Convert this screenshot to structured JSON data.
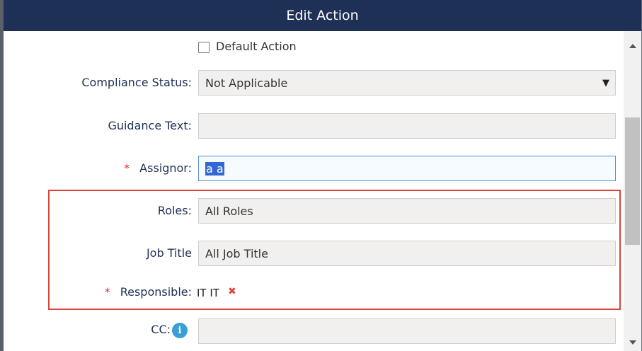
{
  "dialog": {
    "title": "Edit Action"
  },
  "form": {
    "default_action": {
      "label": "Default Action",
      "checked": false
    },
    "compliance_status": {
      "label": "Compliance Status:",
      "value": "Not Applicable"
    },
    "guidance_text": {
      "label": "Guidance Text:",
      "value": ""
    },
    "assignor": {
      "label": "Assignor:",
      "required_mark": "*",
      "value": "a a"
    },
    "roles": {
      "label": "Roles:",
      "value": "All Roles"
    },
    "job_title": {
      "label": "Job Title",
      "value": "All Job Title"
    },
    "responsible": {
      "label": "Responsible:",
      "required_mark": "*",
      "value": "IT IT",
      "remove_glyph": "✖"
    },
    "cc": {
      "label": "CC:",
      "info_glyph": "i",
      "value": ""
    }
  },
  "icons": {
    "dropdown": "caret-down-icon",
    "remove": "remove-icon",
    "info": "info-icon"
  },
  "colors": {
    "header_bg": "#1f3057",
    "required": "#d9342b",
    "highlight_border": "#d9463d",
    "info": "#3a9fd6",
    "selection": "#3367d6"
  }
}
